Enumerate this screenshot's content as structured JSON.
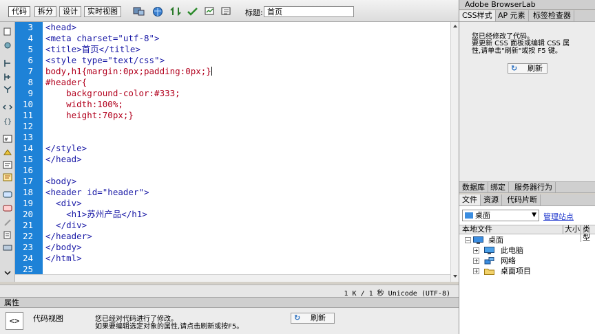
{
  "toolbar": {
    "buttons": [
      "代码",
      "拆分",
      "设计",
      "实时视图"
    ],
    "active_button": "代码",
    "title_label": "标题:",
    "title_value": "首页"
  },
  "editor": {
    "line_numbers": [
      "3",
      "4",
      "5",
      "6",
      "7",
      "8",
      "9",
      "10",
      "11",
      "12",
      "13",
      "14",
      "15",
      "16",
      "17",
      "18",
      "19",
      "20",
      "21",
      "22",
      "23",
      "24",
      "25"
    ],
    "lines": [
      "<head>",
      "<meta charset=\"utf-8\">",
      "<title>首页</title>",
      "<style type=\"text/css\">",
      "body,h1{margin:0px;padding:0px;}",
      "#header{",
      "    background-color:#333;",
      "    width:100%;",
      "    height:70px;}",
      "",
      "",
      "</style>",
      "</head>",
      "",
      "<body>",
      "<header id=\"header\">",
      "  <div>",
      "    <h1>苏州产品</h1>",
      "  </div>",
      "</header>",
      "</body>",
      "</html>",
      ""
    ],
    "status": "1 K / 1 秒 Unicode (UTF-8)"
  },
  "properties": {
    "tab": "属性",
    "view_label": "代码视图",
    "message_line1": "您已经对代码进行了修改。",
    "message_line2": "如果要编辑选定对象的属性,请点击刷新或按F5。",
    "refresh": "刷新",
    "icon_glyph": "<>"
  },
  "right_panel": {
    "title": "Adobe BrowserLab",
    "css_tabs": [
      "CSS样式",
      "AP 元素",
      "标签检查器"
    ],
    "css_message1": "您已经修改了代码。",
    "css_message2": "要更新 CSS 面板或编辑 CSS 属",
    "css_message3": "性,请单击\"刷新\"或按 F5 键。",
    "css_refresh": "刷新",
    "db_tabs": [
      "数据库",
      "绑定",
      "服务器行为"
    ],
    "file_tabs": [
      "文件",
      "资源",
      "代码片断"
    ],
    "site_select": "桌面",
    "manage_sites": "管理站点",
    "file_columns": [
      "本地文件",
      "大小",
      "类型"
    ],
    "tree": [
      {
        "label": "桌面",
        "expander": "−",
        "icon": "desktop-icon"
      },
      {
        "label": "此电脑",
        "expander": "+",
        "icon": "computer-icon"
      },
      {
        "label": "网络",
        "expander": "+",
        "icon": "network-icon"
      },
      {
        "label": "桌面项目",
        "expander": "+",
        "icon": "folder-icon"
      }
    ]
  }
}
